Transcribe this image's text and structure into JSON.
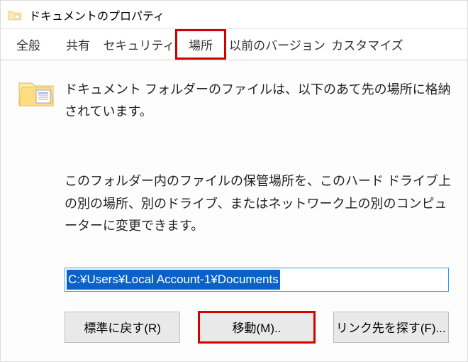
{
  "window": {
    "title": "ドキュメントのプロパティ"
  },
  "tabs": {
    "general": "全般",
    "sharing": "共有",
    "security": "セキュリティ",
    "location": "場所",
    "previous": "以前のバージョン",
    "customize": "カスタマイズ"
  },
  "location_tab": {
    "intro": "ドキュメント フォルダーのファイルは、以下のあて先の場所に格納されています。",
    "description": "このフォルダー内のファイルの保管場所を、このハード ドライブ上の別の場所、別のドライブ、またはネットワーク上の別のコンピューターに変更できます。",
    "path_value": "C:¥Users¥Local Account-1¥Documents",
    "buttons": {
      "restore": "標準に戻す(R)",
      "move": "移動(M)..",
      "find": "リンク先を探す(F)..."
    }
  }
}
